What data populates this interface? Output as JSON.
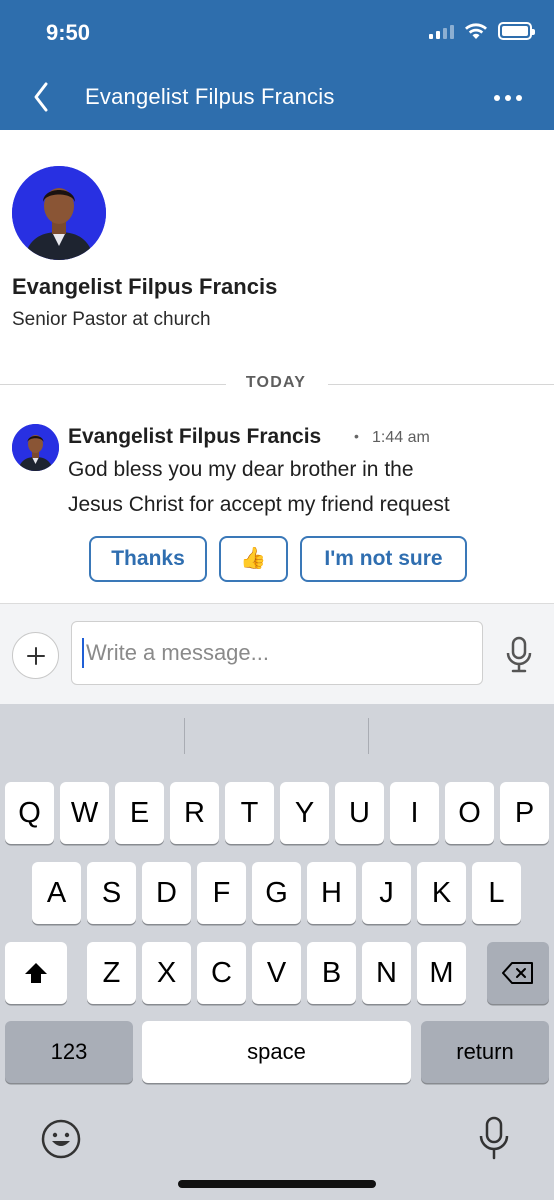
{
  "status_bar": {
    "time": "9:50"
  },
  "header": {
    "title": "Evangelist Filpus Francis",
    "back_icon": "chevron-left-icon",
    "more_icon": "more-horizontal-icon",
    "color": "#2e6ead"
  },
  "profile": {
    "name": "Evangelist Filpus Francis",
    "headline": "Senior Pastor at church"
  },
  "divider": {
    "label": "TODAY"
  },
  "message": {
    "sender": "Evangelist Filpus Francis",
    "separator": "•",
    "time": "1:44 am",
    "lines": [
      "God bless you my dear brother in the",
      "Jesus Christ for accept my friend request"
    ]
  },
  "quick_replies": [
    {
      "label": "Thanks"
    },
    {
      "label": "👍"
    },
    {
      "label": "I'm not sure"
    }
  ],
  "compose": {
    "placeholder": "Write a message...",
    "add_label": "+"
  },
  "keyboard": {
    "row1": [
      "Q",
      "W",
      "E",
      "R",
      "T",
      "Y",
      "U",
      "I",
      "O",
      "P"
    ],
    "row2": [
      "A",
      "S",
      "D",
      "F",
      "G",
      "H",
      "J",
      "K",
      "L"
    ],
    "row3": [
      "Z",
      "X",
      "C",
      "V",
      "B",
      "N",
      "M"
    ],
    "numbers_label": "123",
    "space_label": "space",
    "return_label": "return"
  },
  "colors": {
    "accent": "#2e6ead",
    "reply_border": "#3a78b8",
    "keyboard_bg": "#d1d4da"
  }
}
